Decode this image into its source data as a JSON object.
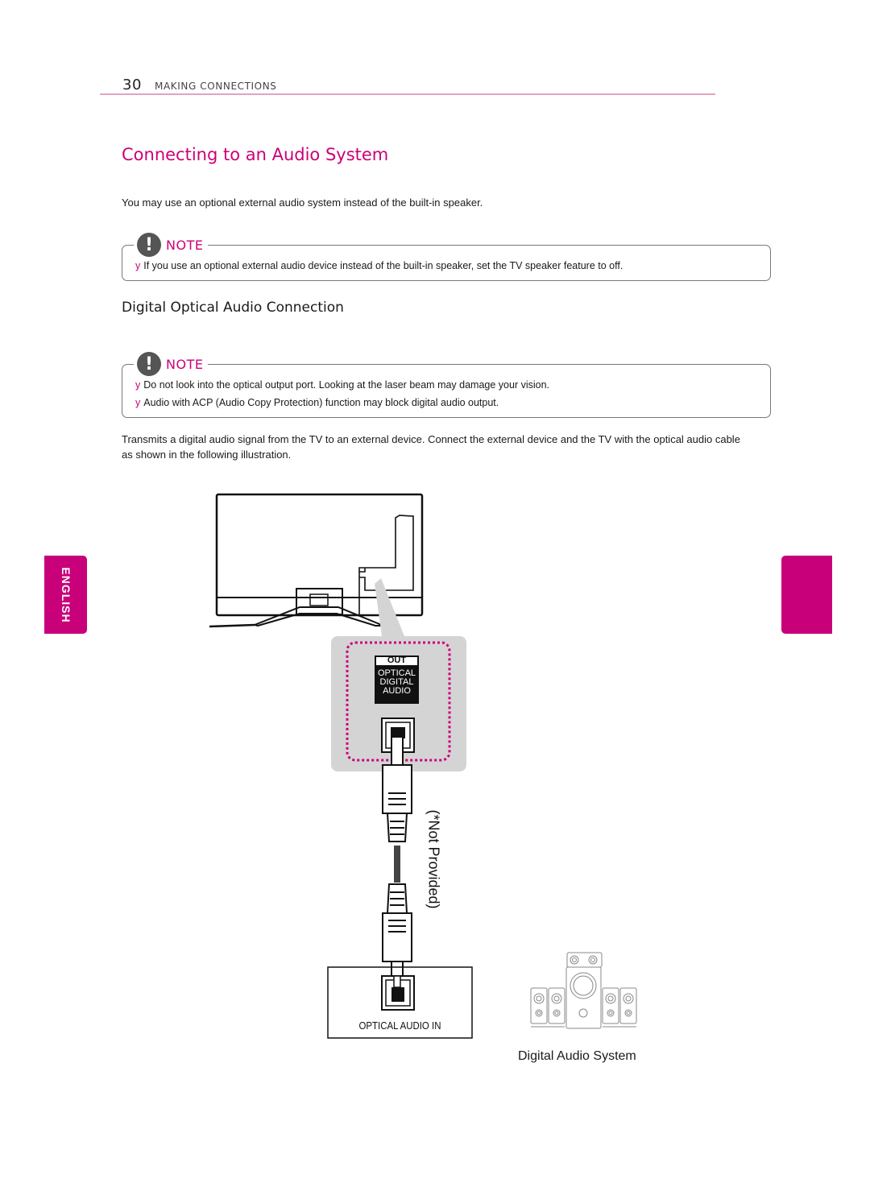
{
  "header": {
    "page_number": "30",
    "section": "MAKING CONNECTIONS"
  },
  "title": "Connecting to an Audio System",
  "intro": "You may use an optional external audio system instead of the built-in speaker.",
  "note1": {
    "label": "NOTE",
    "icon": "exclamation-icon",
    "bullet": "y",
    "items": [
      "If you use an optional external audio device instead of the built-in speaker, set the TV speaker feature to off."
    ]
  },
  "subtitle": "Digital Optical Audio Connection",
  "note2": {
    "label": "NOTE",
    "icon": "exclamation-icon",
    "bullet": "y",
    "items": [
      "Do not look into the optical output port. Looking at the laser beam may damage your vision.",
      "Audio with ACP (Audio Copy Protection) function may block digital audio output."
    ]
  },
  "body": "Transmits a digital audio signal from the TV to an external device. Connect the external device and the TV with the optical audio cable as shown in the following illustration.",
  "side_tab": {
    "label": "ENGLISH"
  },
  "illustration": {
    "port_out_label": "OUT",
    "port_out_lines": [
      "OPTICAL",
      "DIGITAL",
      "AUDIO"
    ],
    "cable_note": "(*Not Provided)",
    "port_in_label": "OPTICAL AUDIO IN",
    "device_caption": "Digital Audio System"
  },
  "colors": {
    "accent": "#cc0077",
    "tab": "#c8007a",
    "rule": "#e3a3c3",
    "zoom_panel": "#d4d4d4"
  }
}
